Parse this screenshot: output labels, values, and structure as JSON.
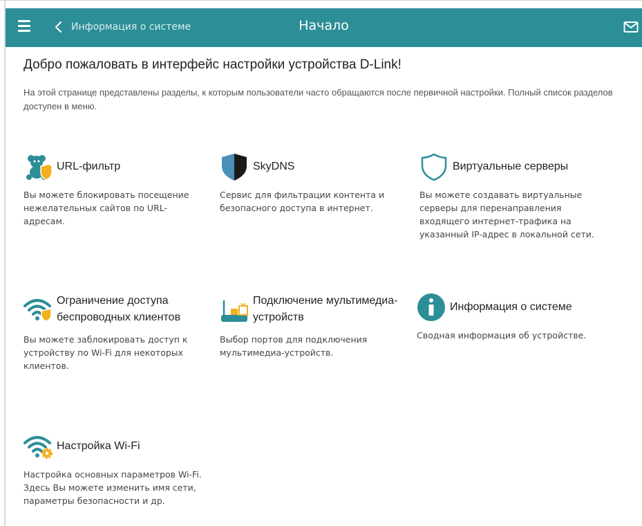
{
  "header": {
    "back_label": "Информация о системе",
    "title": "Начало"
  },
  "main": {
    "welcome": "Добро пожаловать в интерфейс настройки устройства D-Link!",
    "intro": "На этой странице представлены разделы, к которым пользователи часто обращаются после первичной настройки. Полный список разделов доступен в меню."
  },
  "cards": [
    {
      "title": "URL-фильтр",
      "desc": "Вы можете блокировать посещение нежелательных сайтов по URL-адресам.",
      "icon": "url-filter-icon"
    },
    {
      "title": "SkyDNS",
      "desc": "Сервис для фильтрации контента и безопасного доступа в интернет.",
      "icon": "skydns-shield-icon"
    },
    {
      "title": "Виртуальные серверы",
      "desc": "Вы можете создавать виртуальные серверы для перенаправления входящего интернет-трафика на указанный IP-адрес в локальной сети.",
      "icon": "shield-outline-icon"
    },
    {
      "title": "Ограничение доступа беспроводных клиентов",
      "desc": "Вы можете заблокировать доступ к устройству по Wi-Fi для некоторых клиентов.",
      "icon": "wifi-shield-icon"
    },
    {
      "title": "Подключение мультимедиа-устройств",
      "desc": "Выбор портов для подключения мультимедиа-устройств.",
      "icon": "router-tv-icon"
    },
    {
      "title": "Информация о системе",
      "desc": "Сводная информация об устройстве.",
      "icon": "info-icon"
    },
    {
      "title": "Настройка Wi-Fi",
      "desc": "Настройка основных параметров Wi-Fi. Здесь Вы можете изменить имя сети, параметры безопасности и др.",
      "icon": "wifi-gear-icon"
    }
  ],
  "colors": {
    "header": "#2c8e97",
    "icon_teal": "#2c8e97",
    "icon_gold": "#f2b01e"
  }
}
